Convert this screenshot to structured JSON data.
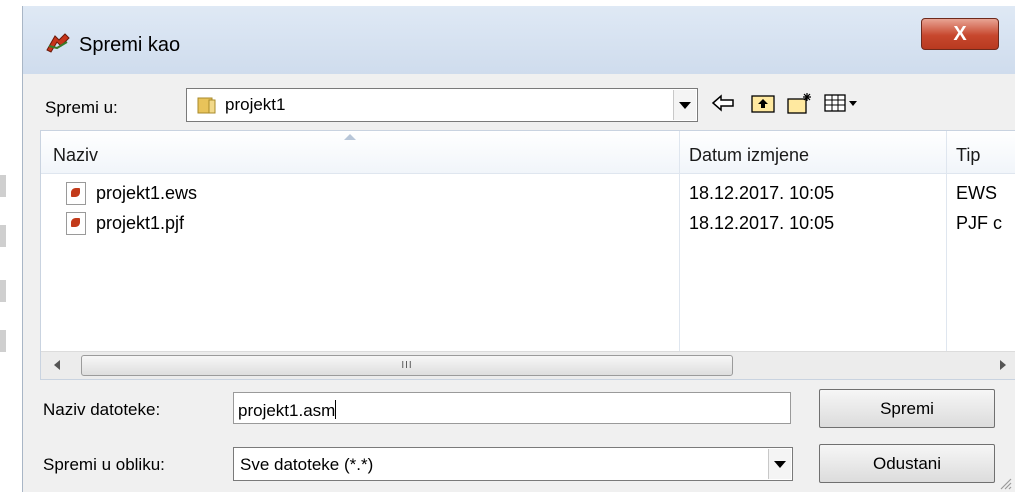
{
  "window": {
    "title": "Spremi kao",
    "close_label": "X"
  },
  "save_in": {
    "label": "Spremi u:",
    "value": "projekt1"
  },
  "toolbar": {
    "icons": [
      "back-arrow-icon",
      "up-folder-icon",
      "new-folder-icon",
      "view-menu-icon"
    ]
  },
  "file_list": {
    "columns": [
      "Naziv",
      "Datum izmjene",
      "Tip"
    ],
    "rows": [
      {
        "name": "projekt1.ews",
        "date": "18.12.2017. 10:05",
        "type": "EWS"
      },
      {
        "name": "projekt1.pjf",
        "date": "18.12.2017. 10:05",
        "type": "PJF c"
      }
    ],
    "scroll_grip": "III"
  },
  "file_name": {
    "label": "Naziv datoteke:",
    "value": "projekt1.asm"
  },
  "file_type": {
    "label": "Spremi u obliku:",
    "value": "Sve datoteke (*.*)"
  },
  "buttons": {
    "save": "Spremi",
    "cancel": "Odustani"
  }
}
